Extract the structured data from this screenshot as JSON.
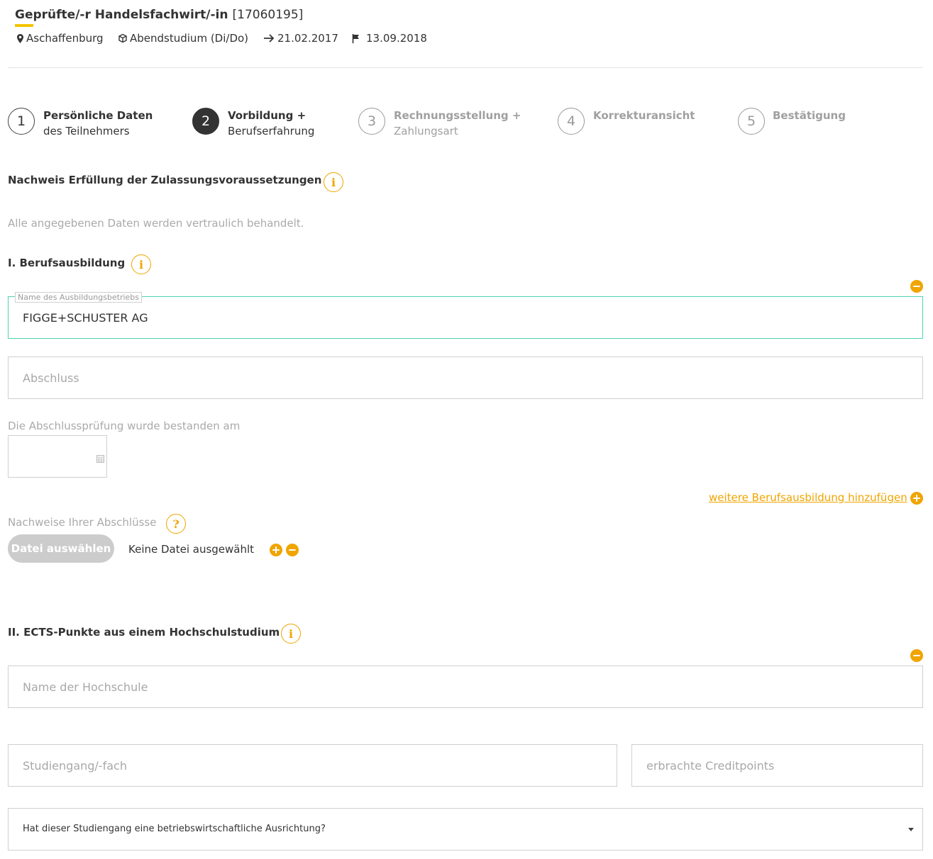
{
  "header": {
    "title": "Geprüfte/-r Handelsfachwirt/-in",
    "code": "[17060195]",
    "location": "Aschaffenburg",
    "format": "Abendstudium (Di/Do)",
    "start_date": "21.02.2017",
    "end_date": "13.09.2018",
    "accent_color": "#f5c400"
  },
  "steps": [
    {
      "number": "1",
      "title": "Persönliche Daten",
      "subtitle": "des Teilnehmers",
      "state": "done"
    },
    {
      "number": "2",
      "title": "Vorbildung +",
      "subtitle": "Berufserfahrung",
      "state": "active"
    },
    {
      "number": "3",
      "title": "Rechnungsstellung +",
      "subtitle": "Zahlungsart",
      "state": "inactive"
    },
    {
      "number": "4",
      "title": "Korrekturansicht",
      "subtitle": "",
      "state": "inactive"
    },
    {
      "number": "5",
      "title": "Bestätigung",
      "subtitle": "",
      "state": "inactive"
    }
  ],
  "main": {
    "heading": "Nachweis Erfüllung der Zulassungsvoraussetzungen",
    "privacy_note": "Alle angegebenen Daten werden vertraulich behandelt.",
    "section1": {
      "heading": "I. Berufsausbildung",
      "company_label": "Name des Ausbildungsbetriebs",
      "company_value": "FIGGE+SCHUSTER AG",
      "degree_placeholder": "Abschluss",
      "exam_date_label": "Die Abschlussprüfung wurde bestanden am",
      "exam_date_value": "",
      "add_link": "weitere Berufsausbildung hinzufügen",
      "proofs_label": "Nachweise Ihrer Abschlüsse",
      "file_button": "Datei auswählen",
      "file_status": "Keine Datei ausgewählt"
    },
    "section2": {
      "heading": "II. ECTS-Punkte aus einem Hochschulstudium",
      "university_placeholder": "Name der Hochschule",
      "course_placeholder": "Studiengang/-fach",
      "credits_placeholder": "erbrachte Creditpoints",
      "business_select": "Hat dieser Studiengang eine betriebswirtschaftliche Ausrichtung?"
    }
  },
  "colors": {
    "accent": "#f0a500",
    "focus_border": "#4fd1b0",
    "muted_text": "#aaaaaa"
  },
  "icons": [
    "map-pin-icon",
    "cube-icon",
    "arrow-right-icon",
    "flag-icon",
    "info-icon",
    "help-icon",
    "calendar-icon",
    "plus-icon",
    "minus-icon",
    "caret-down-icon"
  ]
}
